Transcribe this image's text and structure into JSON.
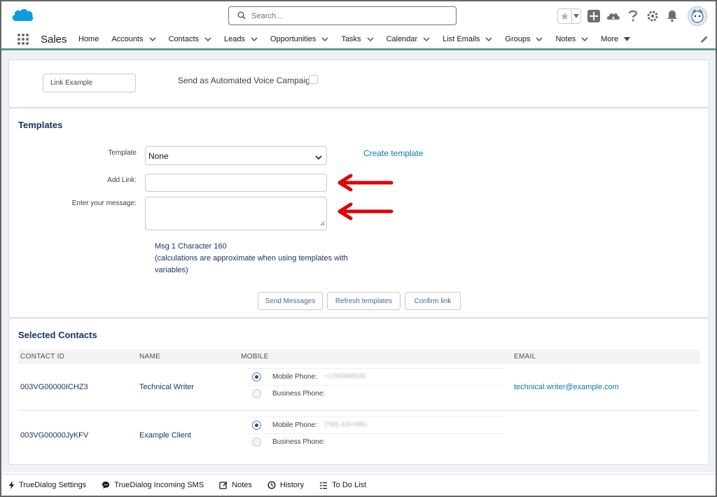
{
  "header": {
    "search_placeholder": "Search...",
    "icons": [
      "favorites-star-icon",
      "add-icon",
      "trailhead-icon",
      "help-icon",
      "setup-gear-icon",
      "notifications-bell-icon",
      "user-avatar"
    ]
  },
  "nav": {
    "app_name": "Sales",
    "items": [
      {
        "label": "Home",
        "has_menu": false
      },
      {
        "label": "Accounts",
        "has_menu": true
      },
      {
        "label": "Contacts",
        "has_menu": true
      },
      {
        "label": "Leads",
        "has_menu": true
      },
      {
        "label": "Opportunities",
        "has_menu": true
      },
      {
        "label": "Tasks",
        "has_menu": true
      },
      {
        "label": "Calendar",
        "has_menu": true
      },
      {
        "label": "List Emails",
        "has_menu": true
      },
      {
        "label": "Groups",
        "has_menu": true
      },
      {
        "label": "Notes",
        "has_menu": true
      },
      {
        "label": "More",
        "has_menu": true
      }
    ],
    "accent_color": "#5a9b8f"
  },
  "top_card": {
    "link_example_label": "Link Example",
    "voice_campaign_label": "Send as Automated Voice Campaign",
    "voice_campaign_checked": false
  },
  "templates": {
    "title": "Templates",
    "template_label": "Template",
    "template_value": "None",
    "create_template_link": "Create template",
    "add_link_label": "Add Link:",
    "add_link_value": "",
    "message_label": "Enter your message:",
    "message_value": "",
    "info_line1": "Msg 1 Character 160",
    "info_line2": "(calculations are approximate when using templates with variables)",
    "buttons": {
      "send": "Send Messages",
      "refresh": "Refresh templates",
      "confirm": "Confirm link"
    },
    "annotation_color": "#e00000"
  },
  "contacts": {
    "title": "Selected Contacts",
    "columns": [
      "CONTACT ID",
      "NAME",
      "MOBILE",
      "EMAIL"
    ],
    "rows": [
      {
        "contact_id": "003VG00000ICHZ3",
        "name": "Technical Writer",
        "mobile_phone_label": "Mobile Phone:",
        "mobile_phone_value": "+17603848182",
        "business_phone_label": "Business Phone:",
        "email": "technical.writer@example.com"
      },
      {
        "contact_id": "003VG00000JyKFV",
        "name": "Example Client",
        "mobile_phone_label": "Mobile Phone:",
        "mobile_phone_value": "(760) 426-0951",
        "business_phone_label": "Business Phone:",
        "email": ""
      }
    ]
  },
  "footer": {
    "items": [
      {
        "label": "TrueDialog Settings",
        "icon": "lightning-icon"
      },
      {
        "label": "TrueDialog Incoming SMS",
        "icon": "chat-bubble-icon"
      },
      {
        "label": "Notes",
        "icon": "notes-icon"
      },
      {
        "label": "History",
        "icon": "clock-icon"
      },
      {
        "label": "To Do List",
        "icon": "checklist-icon"
      }
    ]
  }
}
